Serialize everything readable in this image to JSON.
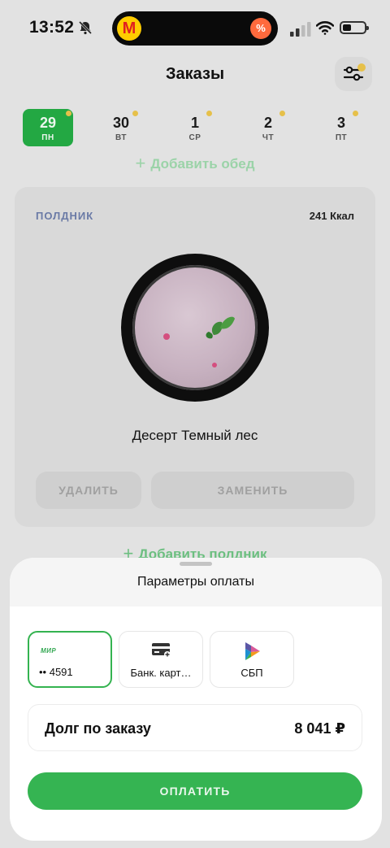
{
  "status_bar": {
    "time": "13:52",
    "island_logo": "М",
    "island_badge": "%"
  },
  "header": {
    "title": "Заказы",
    "filter_icon": "sliders-icon"
  },
  "days": [
    {
      "num": "29",
      "weekday": "ПН",
      "selected": true,
      "has_dot": true
    },
    {
      "num": "30",
      "weekday": "ВТ",
      "selected": false,
      "has_dot": true
    },
    {
      "num": "1",
      "weekday": "СР",
      "selected": false,
      "has_dot": true
    },
    {
      "num": "2",
      "weekday": "ЧТ",
      "selected": false,
      "has_dot": true
    },
    {
      "num": "3",
      "weekday": "ПТ",
      "selected": false,
      "has_dot": true
    }
  ],
  "add_lunch": {
    "plus": "+",
    "label": "Добавить обед"
  },
  "meal": {
    "type": "ПОЛДНИК",
    "kcal": "241 Ккал",
    "name": "Десерт Темный лес",
    "delete_label": "УДАЛИТЬ",
    "replace_label": "ЗАМЕНИТЬ"
  },
  "add_snack": {
    "plus": "+",
    "label": "Добавить полдник"
  },
  "payment_sheet": {
    "title": "Параметры оплаты",
    "methods": [
      {
        "logo": "МИР",
        "label": "•• 4591",
        "selected": true
      },
      {
        "icon": "bank-card-icon",
        "label": "Банк. карт…",
        "selected": false
      },
      {
        "icon": "sbp-icon",
        "label": "СБП",
        "selected": false
      }
    ],
    "debt_label": "Долг по заказу",
    "debt_amount": "8 041 ₽",
    "pay_label": "ОПЛАТИТЬ"
  },
  "colors": {
    "accent_green": "#35b452",
    "dot_yellow": "#e6c04a",
    "meal_type_blue": "#6a7aa6"
  }
}
